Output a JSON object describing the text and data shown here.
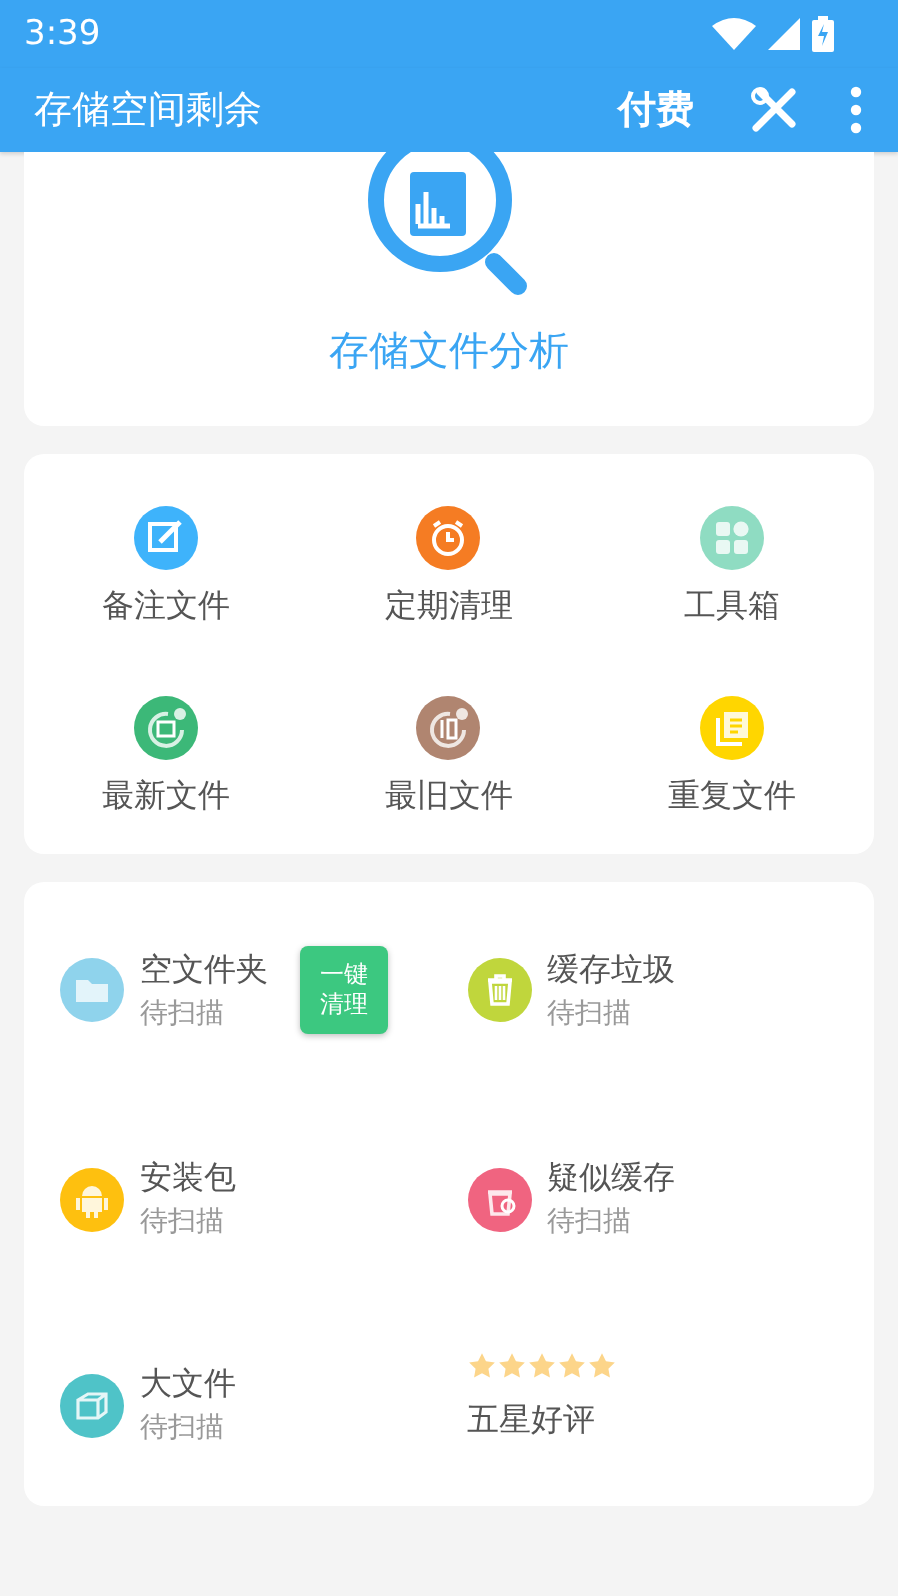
{
  "status_bar": {
    "time": "3:39"
  },
  "app_bar": {
    "title": "存储空间剩余",
    "action": "付费"
  },
  "analysis": {
    "label": "存储文件分析"
  },
  "shortcuts": [
    {
      "label": "备注文件",
      "color": "#3eb3fb"
    },
    {
      "label": "定期清理",
      "color": "#f57c23"
    },
    {
      "label": "工具箱",
      "color": "#8fdcc2"
    },
    {
      "label": "最新文件",
      "color": "#3cb878"
    },
    {
      "label": "最旧文件",
      "color": "#b08570"
    },
    {
      "label": "重复文件",
      "color": "#ffd600"
    }
  ],
  "scan_items": [
    {
      "kind": "scan",
      "title": "空文件夹",
      "status": "待扫描",
      "color": "#8fd3ec",
      "button": "一键清理"
    },
    {
      "kind": "scan",
      "title": "缓存垃圾",
      "status": "待扫描",
      "color": "#c0d63c"
    },
    {
      "kind": "scan",
      "title": "安装包",
      "status": "待扫描",
      "color": "#fec00f"
    },
    {
      "kind": "scan",
      "title": "疑似缓存",
      "status": "待扫描",
      "color": "#f06480"
    },
    {
      "kind": "scan",
      "title": "大文件",
      "status": "待扫描",
      "color": "#4fc3c8"
    },
    {
      "kind": "rating",
      "title": "五星好评",
      "stars": 5
    }
  ]
}
